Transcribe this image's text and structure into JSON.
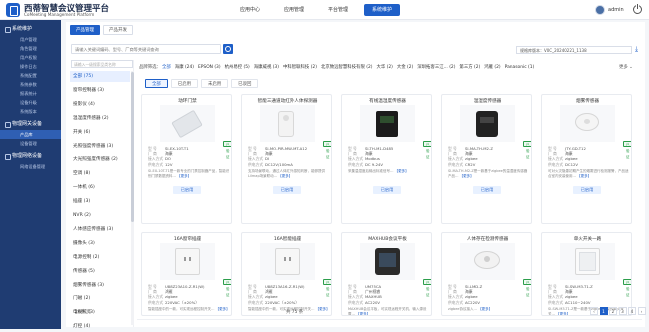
{
  "brand": {
    "title": "西蒂智慧会议管理平台",
    "subtitle": "CoMeeting Management Platform"
  },
  "topnav": [
    {
      "label": "应用中心",
      "active": false
    },
    {
      "label": "应用管理",
      "active": false
    },
    {
      "label": "平台管理",
      "active": false
    },
    {
      "label": "系统维护",
      "active": true
    }
  ],
  "user": {
    "name": "admin"
  },
  "sidebar": {
    "sections": [
      {
        "label": "系统维护",
        "items": [
          "用户管理",
          "角色管理",
          "用户权限",
          "操作日志",
          "系统配置",
          "系统参数",
          "报表统计",
          "设备升级",
          "系统版本"
        ]
      },
      {
        "label": "物理网关设备",
        "items": [
          "产品库",
          "设备管理"
        ]
      },
      {
        "label": "物理网络设备",
        "items": [
          "网络设备管理"
        ]
      }
    ],
    "active_item": "产品库"
  },
  "tabs": [
    {
      "label": "产品管理",
      "active": true
    },
    {
      "label": "产品开发",
      "active": false
    }
  ],
  "search": {
    "placeholder": "请输入关键词编码、型号、厂商等关键词查询"
  },
  "version": {
    "text": "规格库版本：V0C_20240221_1138"
  },
  "category_search": {
    "placeholder": "请输入一级搜索品类名称"
  },
  "categories": [
    "全部 (75)",
    "窗帘控制器 (3)",
    "投影仪 (4)",
    "温湿度传感器 (2)",
    "开关 (6)",
    "光照强度传感器 (3)",
    "大光照强度传感器 (2)",
    "空调 (8)",
    "一体机 (6)",
    "插座 (3)",
    "NVR (2)",
    "人体感应传感器 (3)",
    "摄像头 (3)",
    "电源控制 (2)",
    "传感器 (5)",
    "烟雾传感器 (3)",
    "门磁 (2)",
    "电视机 (3)",
    "灯控 (4)"
  ],
  "brand_filter": {
    "label": "品牌筛选：",
    "items": [
      "全部",
      "海康 (24)",
      "EPSON (3)",
      "杭州易控 (5)",
      "海康威视 (3)",
      "中科智联科技 (2)",
      "北京致远智慧科技有限 (2)",
      "大华 (2)",
      "大金 (2)",
      "深圳拓客三江... (2)",
      "第三方 (2)",
      "鸿雁 (2)",
      "Panasonic (1)"
    ],
    "more": "更多 ⌄"
  },
  "status_filters": [
    {
      "label": "全部",
      "active": true
    },
    {
      "label": "已启用",
      "active": false
    },
    {
      "label": "未启用",
      "active": false
    },
    {
      "label": "已驳回",
      "active": false
    }
  ],
  "labels": {
    "model": "型  号",
    "vendor": "厂  商",
    "access": "接入方式",
    "power": "供电方式",
    "more_link": "【更多】"
  },
  "cards": [
    {
      "title": "动环门禁",
      "badge": "已验证",
      "model": "SI-EX-10T-T1",
      "vendor": "海康",
      "access": "DO",
      "power": "12V",
      "desc": "SI-EX-10T-T1是一款专业的门禁控制器产品，智能识别门禁数据资料…",
      "button": "已启用"
    },
    {
      "title": "智能三通道动红外人体探测器",
      "badge": "已验证",
      "model": "SI-MO-PIR-MW-MT-A12",
      "vendor": "海康",
      "access": "DI",
      "power": "DC12V/100mA",
      "desc": "支持场景联动，通过人体红外感知判断，能够提供Lilmap场景联动…",
      "button": "已启用"
    },
    {
      "title": "有线温湿度传感器",
      "badge": "已验证",
      "model": "SI-TH-M1-D485",
      "vendor": "海康",
      "access": "Modbus",
      "power": "DC 9-24V",
      "desc": "采集温湿度后输出标准信号…",
      "button": "已启用"
    },
    {
      "title": "温湿度传感器",
      "badge": "已验证",
      "model": "SI-MA-TH-M2-Z",
      "vendor": "海康",
      "access": "zigbee",
      "power": "CR2V",
      "desc": "SI-MA-TH-M2-Z是一款基于zigbee的温湿度传感器产品…",
      "button": "已启用"
    },
    {
      "title": "烟雾传感器",
      "badge": "已验证",
      "model": "JTY-GD-T12",
      "vendor": "海康",
      "access": "zigbee",
      "power": "DC12V",
      "desc": "可对火灾隐患初期产生的烟雾进行检测报警，产品适合室内安装使用…",
      "button": "已启用"
    },
    {
      "title": "16A窗帘插座",
      "badge": "已验证",
      "model": "U88Z23A10-Z-R1(W)",
      "vendor": "鸿雁",
      "access": "zigbee",
      "power": "220VAC（±20%）",
      "desc": "智能插座中的一款，可实现远程控制开关…",
      "button": "已启用"
    },
    {
      "title": "16A智能插座",
      "badge": "已验证",
      "model": "U88Z13A16-Z-R1(W)",
      "vendor": "鸿雁",
      "access": "zigbee",
      "power": "220VAC（±20%）",
      "desc": "智能插座中的一款，可实现远程控制开关…",
      "button": "已启用"
    },
    {
      "title": "MAXHUB会议平板",
      "badge": "已验证",
      "model": "UM75CA",
      "vendor": "广州视睿",
      "access": "MAXHUB",
      "power": "AC220V",
      "desc": "MAXHUB会议平板，可实现远程开关机、输入源设置…",
      "button": "已启用"
    },
    {
      "title": "人体存在检测传感器",
      "badge": "已验证",
      "model": "SI-LMD-Z",
      "vendor": "海康",
      "access": "zigbee",
      "power": "AC220V",
      "desc": "zigbee协议接入…",
      "button": "已启用"
    },
    {
      "title": "单火开关一路",
      "badge": "已验证",
      "model": "SI-SW-M3-T1-Z",
      "vendor": "海康",
      "access": "zigbee",
      "power": "AC110~240V",
      "desc": "SI-SW-M3-T1-Z是一款基于zigbee协议的单火开关…",
      "button": "已启用"
    }
  ],
  "pager": {
    "page_size": "20条/页",
    "total": "共 75 条",
    "pages": [
      "‹",
      "1",
      "2",
      "3",
      "4",
      "›"
    ],
    "current": "1"
  }
}
